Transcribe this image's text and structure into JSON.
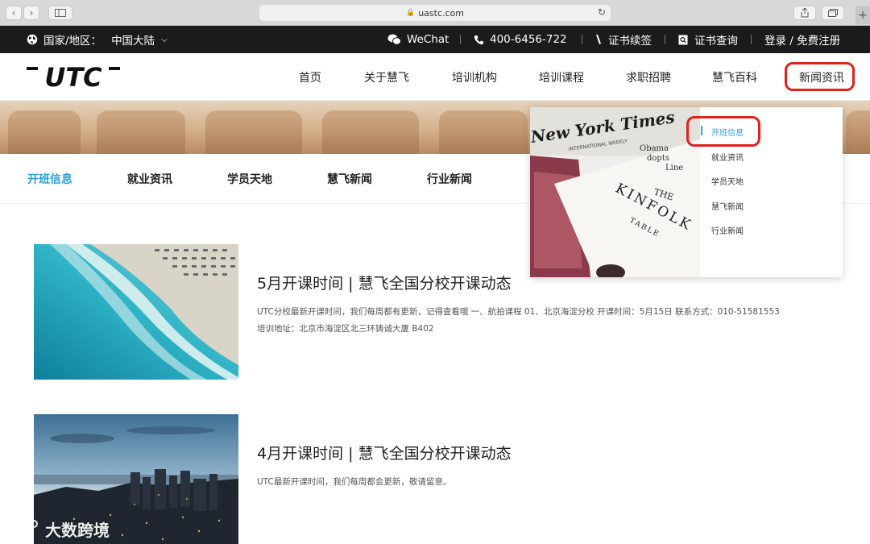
{
  "browser": {
    "url": "uastc.com"
  },
  "topbar": {
    "region_label": "国家/地区：",
    "region_value": "中国大陆",
    "wechat": "WeChat",
    "phone": "400-6456-722",
    "cert_renew": "证书续签",
    "cert_query": "证书查询",
    "login": "登录 / 免费注册"
  },
  "nav": {
    "logo_text": "UTC",
    "items": [
      "首页",
      "关于慧飞",
      "培训机构",
      "培训课程",
      "求职招聘",
      "慧飞百科",
      "新闻资讯"
    ]
  },
  "subnav": {
    "items": [
      "开班信息",
      "就业资讯",
      "学员天地",
      "慧飞新闻",
      "行业新闻"
    ]
  },
  "dropdown": {
    "items": [
      "开班信息",
      "就业资讯",
      "学员天地",
      "慧飞新闻",
      "行业新闻"
    ],
    "photo_text": {
      "newspaper": "New York Times",
      "newspaper_sub": "INTERNATIONAL WEEKLY",
      "headline": "Obama\nAdopts\nLine",
      "book_the": "THE",
      "book_title": "KINFOLK",
      "book_table": "TABLE"
    }
  },
  "articles": [
    {
      "title": "5月开课时间 | 慧飞全国分校开课动态",
      "desc": "UTC分校最新开课时间，我们每周都有更新，记得查看哦 一、航拍课程 01、北京海淀分校 开课时间：5月15日 联系方式：010-51581553 培训地址：北京市海淀区北三环铸诚大厦 B402"
    },
    {
      "title": "4月开课时间 | 慧飞全国分校开课动态",
      "desc": "UTC最新开课时间，我们每周都会更新，敬请留意。"
    }
  ],
  "watermark": "大数跨境",
  "colors": {
    "accent_blue": "#2a9fd8",
    "highlight_red": "#e0201b",
    "topbar_bg": "#1b1b1b"
  }
}
